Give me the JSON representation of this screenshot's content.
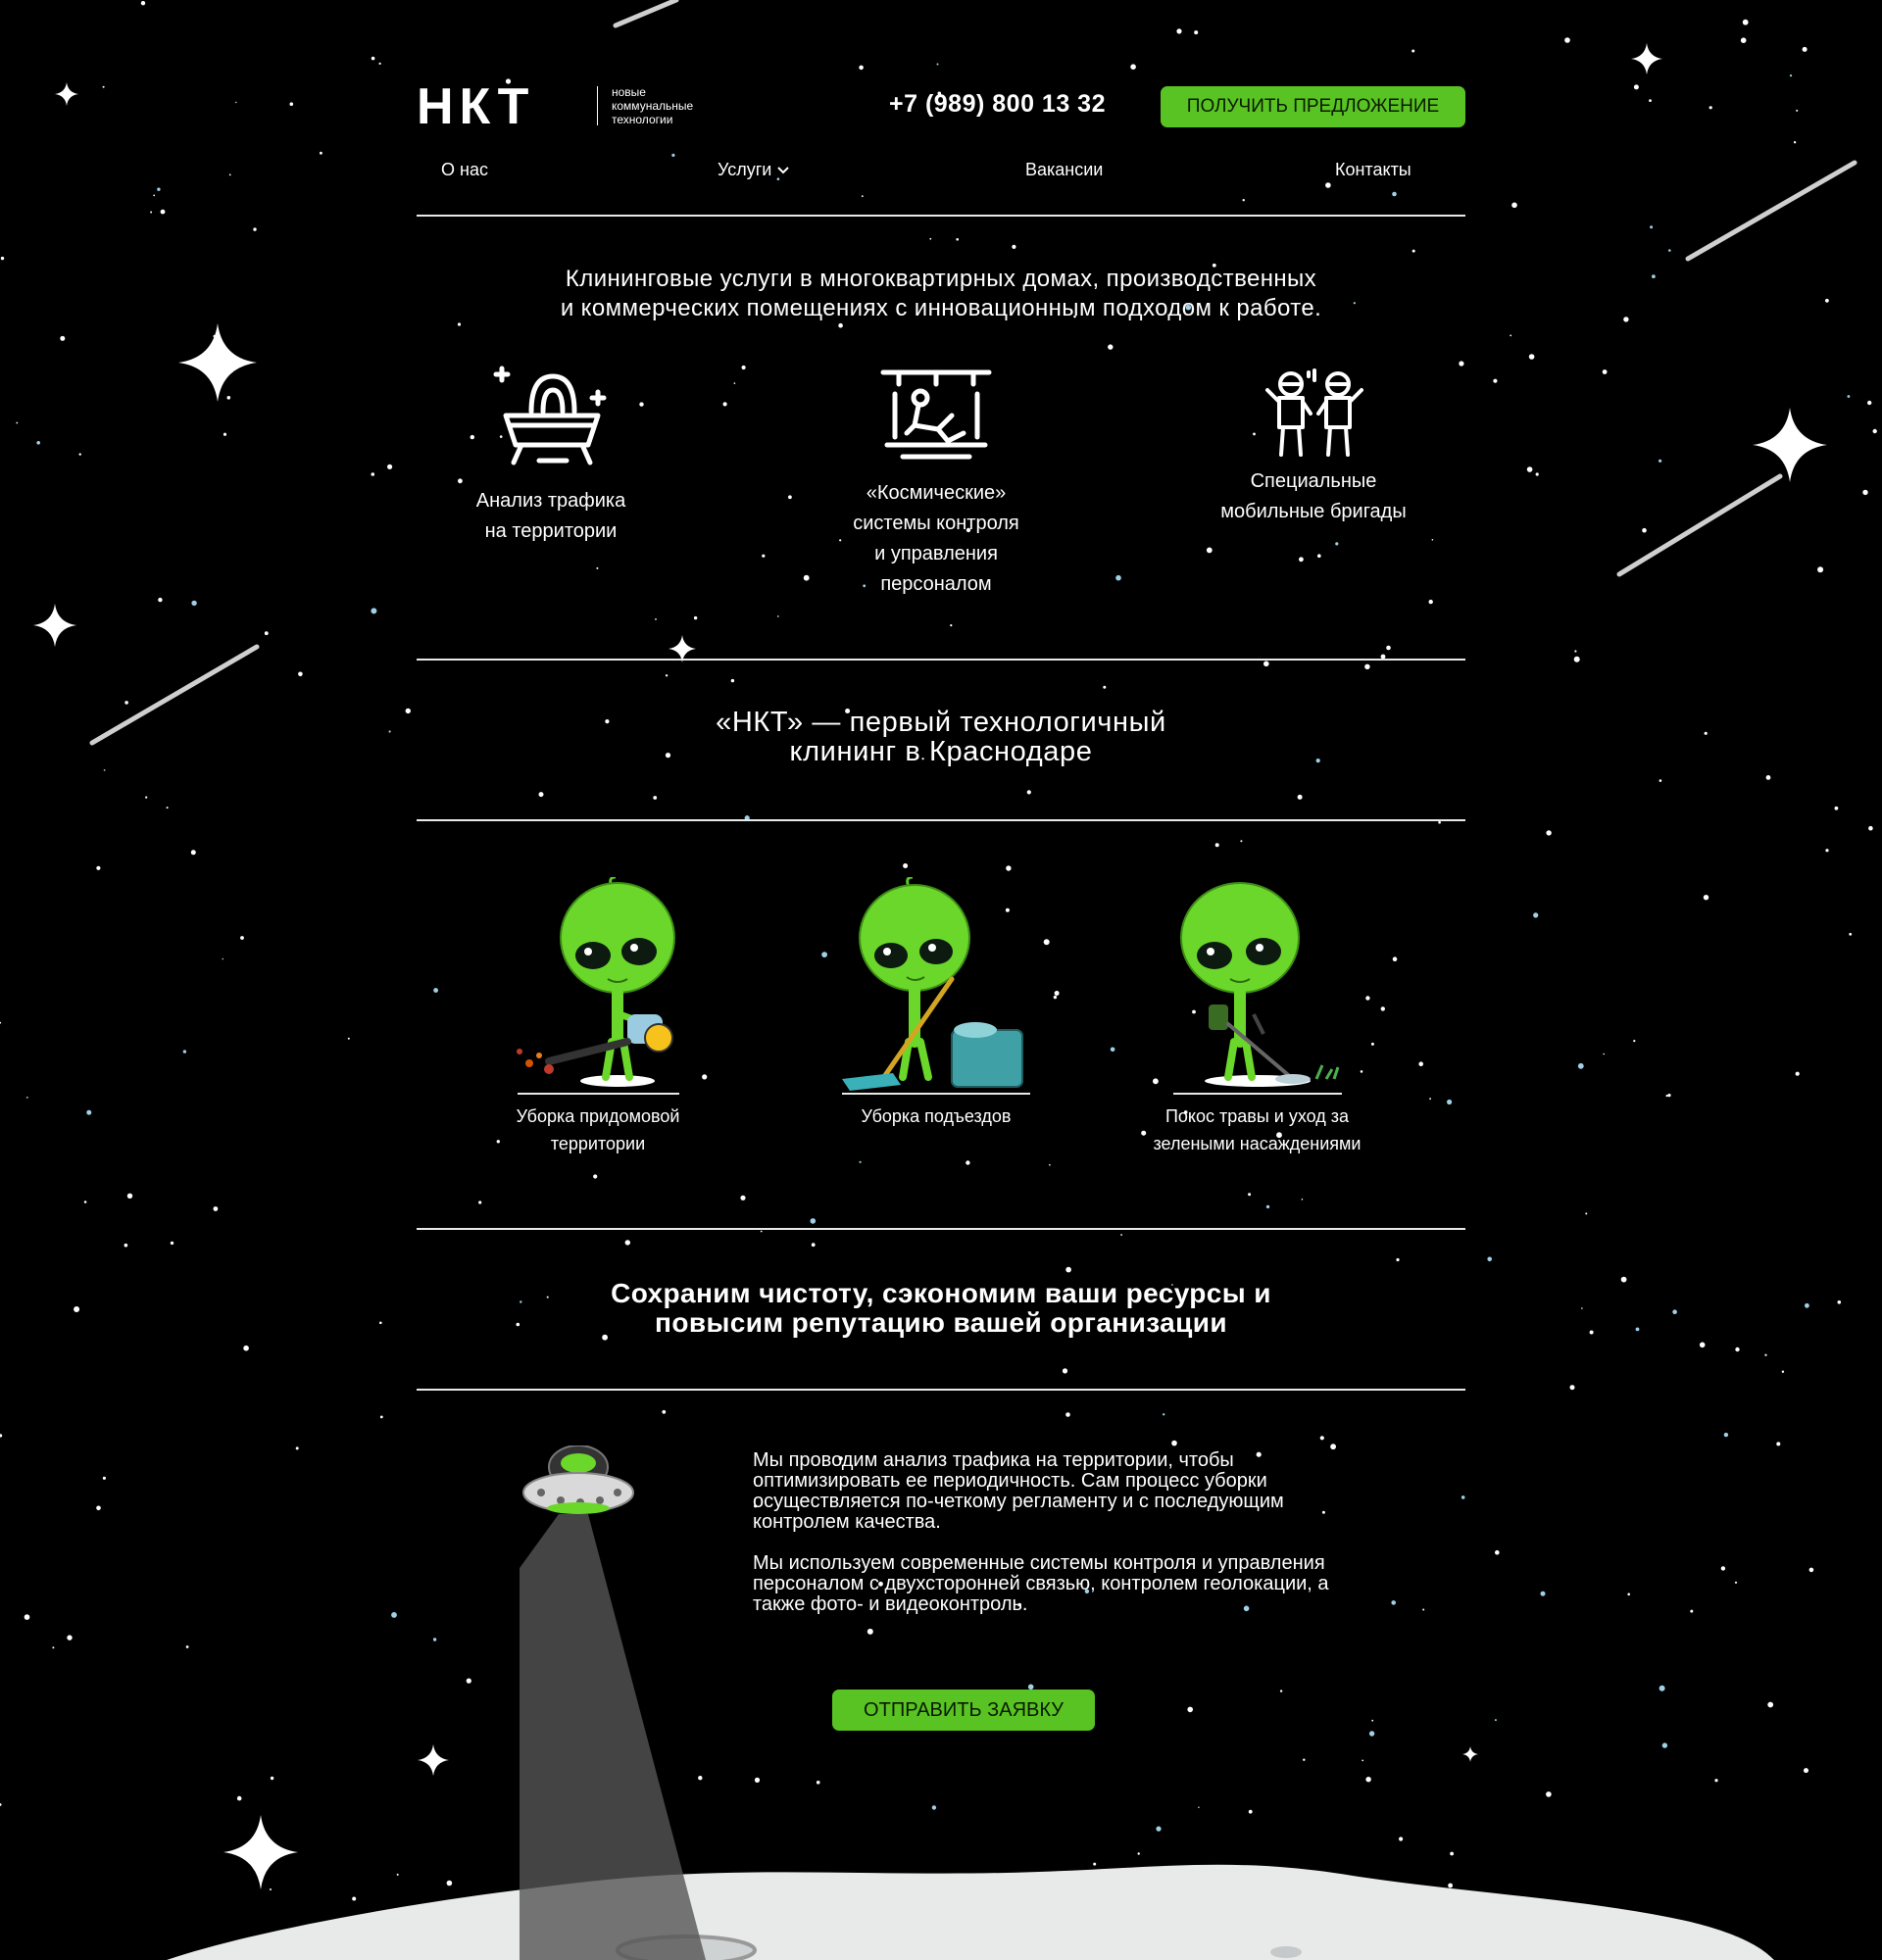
{
  "header": {
    "logo_text": "НКТ",
    "logo_subtitle": [
      "новые",
      "коммунальные",
      "технологии"
    ],
    "phone": "+7 (989) 800 13 32",
    "cta_label": "Получить предложение"
  },
  "nav": {
    "items": [
      {
        "label": "О нас"
      },
      {
        "label": "Услуги",
        "dropdown": true
      },
      {
        "label": "Вакансии"
      },
      {
        "label": "Контакты"
      }
    ]
  },
  "intro": {
    "lines": [
      "Клининговые услуги в многоквартирных домах, производственных",
      "и коммерческих помещениях с инновационным подходом к работе."
    ]
  },
  "features": [
    {
      "icon": "ufo-icon",
      "label_lines": [
        "Анализ трафика",
        "на территории"
      ]
    },
    {
      "icon": "space-control-icon",
      "label_lines": [
        "«Космические»",
        "системы контроля",
        "и управления",
        "персоналом"
      ]
    },
    {
      "icon": "astronauts-icon",
      "label_lines": [
        "Специальные",
        "мобильные бригады"
      ]
    }
  ],
  "headline": {
    "lines": [
      "«НКТ» — первый технологичный",
      "клининг в Краснодаре"
    ]
  },
  "services": [
    {
      "illustration": "alien-leaf-blower",
      "label_lines": [
        "Уборка придомовой",
        "территории"
      ]
    },
    {
      "illustration": "alien-mop",
      "label_lines": [
        "Уборка подъездов"
      ]
    },
    {
      "illustration": "alien-grass-trimmer",
      "label_lines": [
        "Покос травы и уход за",
        "зелеными насаждениями"
      ]
    }
  ],
  "slogan": {
    "lines": [
      "Сохраним чистоту, сэкономим ваши ресурсы и",
      "повысим репутацию вашей организации"
    ]
  },
  "about": {
    "paragraphs": [
      "Мы проводим анализ трафика на территории, чтобы оптимизировать ее периодичность. Сам процесс уборки осуществляется по-четкому регламенту и с последующим контролем качества.",
      "Мы используем современные системы контроля и управления персоналом с двухсторонней связью, контролем геолокации, а также фото- и видеоконтроль."
    ]
  },
  "submit_label": "Отправить заявку",
  "colors": {
    "background": "#000000",
    "accent_green": "#58c322",
    "alien_green": "#6ad72a",
    "text": "#ffffff",
    "moon": "#e8eaea"
  }
}
